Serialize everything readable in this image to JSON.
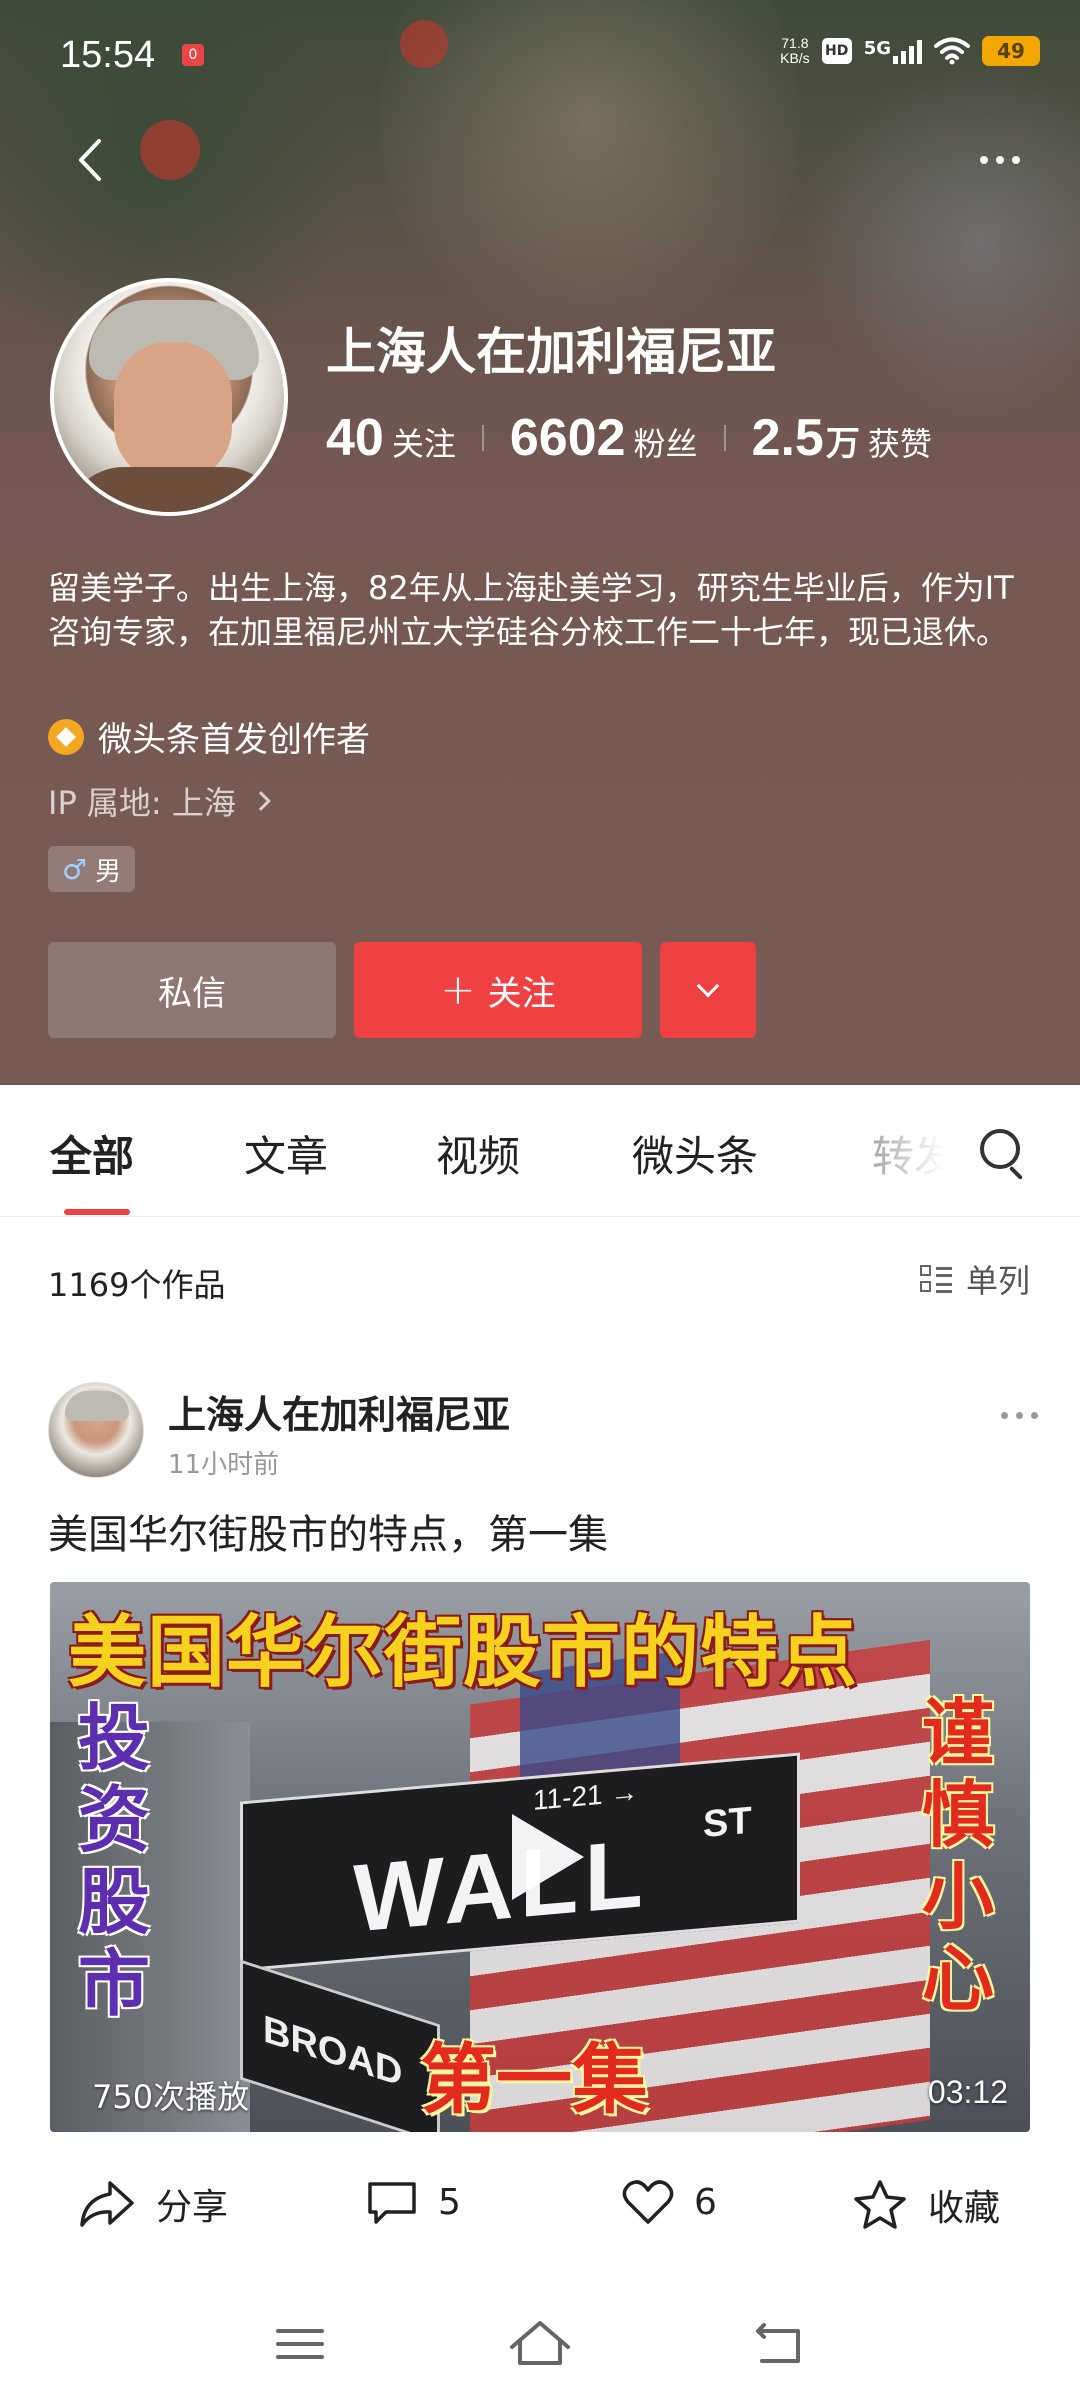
{
  "status_bar": {
    "time": "15:54",
    "notification_badge": "0",
    "net_speed_value": "71.8",
    "net_speed_unit": "KB/s",
    "hd_label": "HD",
    "network_label": "5G",
    "battery": "49"
  },
  "profile": {
    "name": "上海人在加利福尼亚",
    "stats": [
      {
        "value": "40",
        "unit": "",
        "label": "关注"
      },
      {
        "value": "6602",
        "unit": "",
        "label": "粉丝"
      },
      {
        "value": "2.5",
        "unit": "万",
        "label": "获赞"
      }
    ],
    "bio": "留美学子。出生上海，82年从上海赴美学习，研究生毕业后，作为IT咨询专家，在加里福尼州立大学硅谷分校工作二十七年，现已退休。",
    "badge": "微头条首发创作者",
    "ip_location": "IP 属地: 上海",
    "gender": "男"
  },
  "buttons": {
    "message": "私信",
    "follow": "关注",
    "follow_icon": "plus-icon"
  },
  "tabs": [
    {
      "label": "全部",
      "active": true
    },
    {
      "label": "文章",
      "active": false
    },
    {
      "label": "视频",
      "active": false
    },
    {
      "label": "微头条",
      "active": false
    },
    {
      "label": "转发",
      "active": false
    }
  ],
  "works_count": "1169个作品",
  "view_toggle_label": "单列",
  "post": {
    "author": "上海人在加利福尼亚",
    "time": "11小时前",
    "title": "美国华尔街股市的特点，第一集",
    "video": {
      "overlay_title": "美国华尔街股市的特点",
      "left_caption": "投资股市",
      "right_caption": "谨慎小心",
      "episode_caption": "第一集",
      "sign_text": "WALL",
      "sign_suffix": "ST",
      "sign_numbers": "11-21 →",
      "broad_sign": "BROAD",
      "plays": "750次播放",
      "duration": "03:12"
    },
    "actions": {
      "share": "分享",
      "comments": "5",
      "likes": "6",
      "favorite": "收藏"
    }
  },
  "colors": {
    "accent_red": "#f04142",
    "header_bg": "#785a55",
    "battery": "#f2a800"
  }
}
